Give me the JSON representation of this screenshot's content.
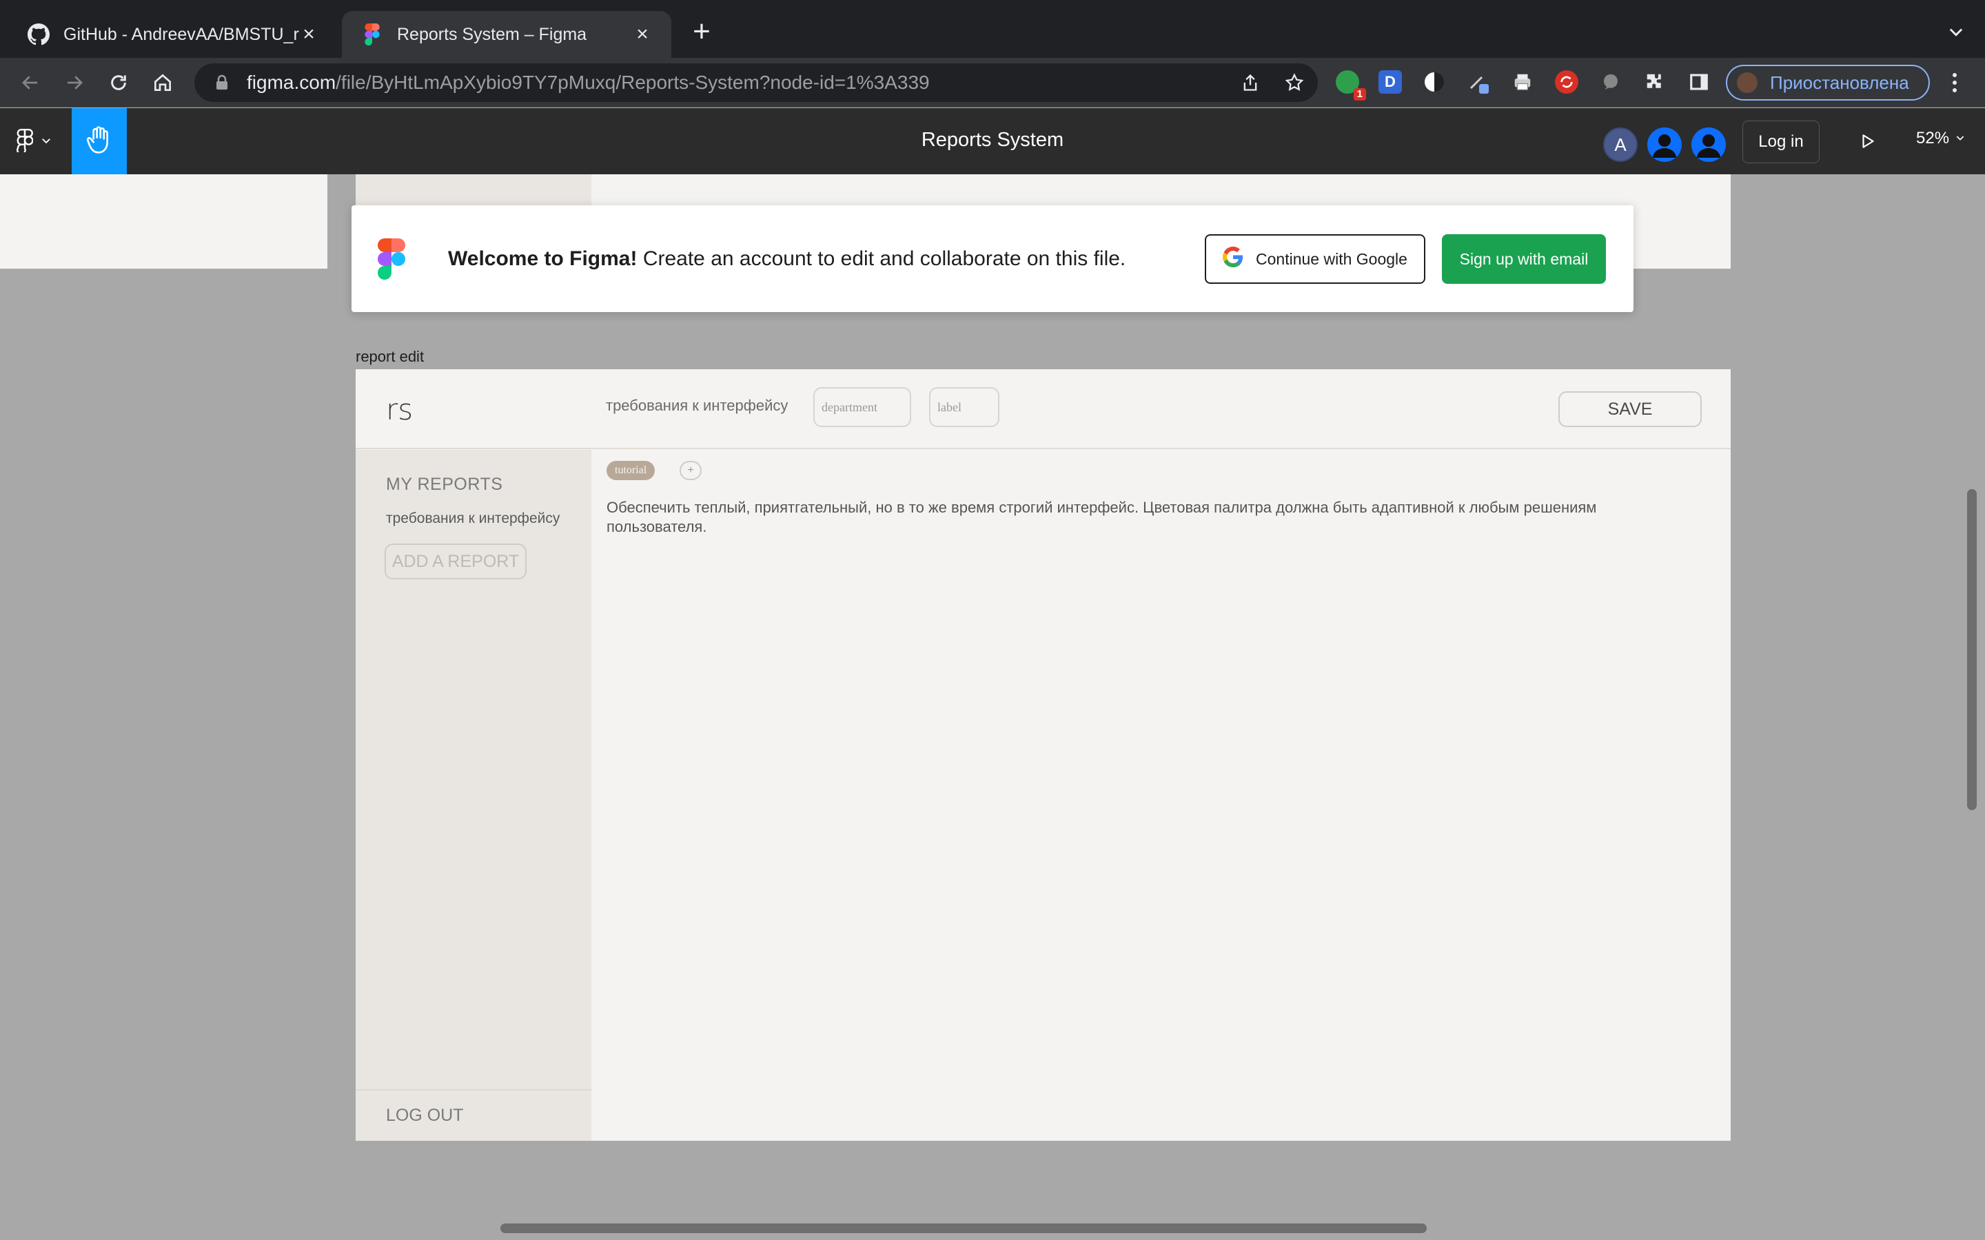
{
  "browser": {
    "tabs": [
      {
        "title": "GitHub - AndreevAA/BMSTU_re",
        "icon": "github-icon"
      },
      {
        "title": "Reports System – Figma",
        "icon": "figma-icon"
      }
    ],
    "url_host": "figma.com",
    "url_path": "/file/ByHtLmApXybio9TY7pMuxq/Reports-System?node-id=1%3A339",
    "extension_badge": "1",
    "extension_letter": "D",
    "profile_label": "Приостановлена"
  },
  "figma": {
    "file_title": "Reports System",
    "avatar_letter": "A",
    "login_label": "Log in",
    "zoom": "52%"
  },
  "welcome": {
    "bold": "Welcome to Figma!",
    "text": " Create an account to edit and collaborate on this file.",
    "google_label": "Continue with Google",
    "email_label": "Sign up with email"
  },
  "frame": {
    "label": "report edit",
    "brand": "rs",
    "doc_title": "требования к интерфейсу",
    "department_placeholder": "department",
    "label_placeholder": "label",
    "save_label": "SAVE",
    "sidebar_heading": "MY REPORTS",
    "sidebar_item": "требования к интерфейсу",
    "add_report": "ADD A REPORT",
    "logout": "LOG OUT",
    "tag": "tutorial",
    "add_tag": "+",
    "body": "Обеспечить теплый, приятгательный, но в то же время строгий интерфейс. Цветовая палитра должна быть адаптивной к любым решениям пользователя."
  },
  "colors": {
    "figma_blue": "#0d99ff",
    "signup_green": "#1aa251",
    "profile_blue": "#8ab4f8"
  }
}
